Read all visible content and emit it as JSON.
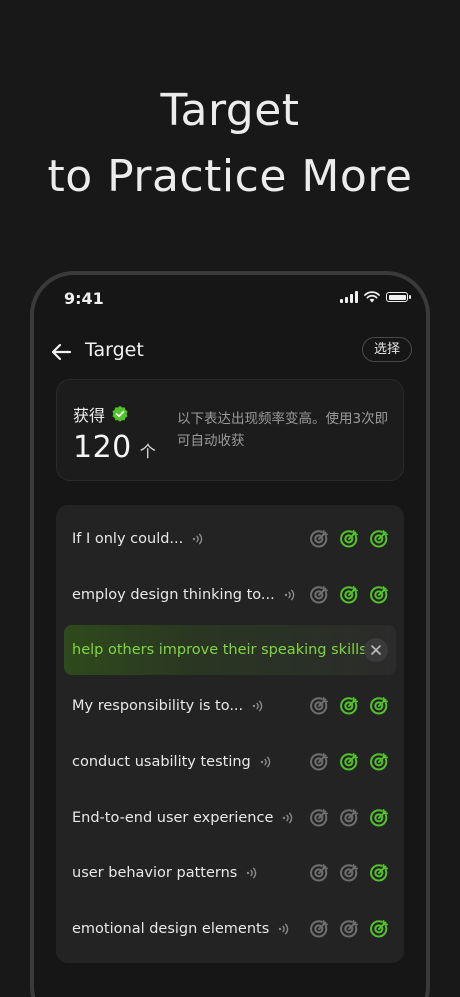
{
  "hero": {
    "line1": "Target",
    "line2": "to Practice More"
  },
  "status_bar": {
    "time": "9:41"
  },
  "nav": {
    "title": "Target",
    "select_label": "选择"
  },
  "reward": {
    "label": "获得",
    "number": "120",
    "unit": "个",
    "description": "以下表达出现频率变高。使用3次即可自动收获"
  },
  "colors": {
    "accent_green": "#52c22b",
    "inactive_gray": "#6e6e6e",
    "highlight_text": "#7fd642"
  },
  "phrases": [
    {
      "text": "If I only could...",
      "targets_done": 2
    },
    {
      "text": "employ design thinking to...",
      "targets_done": 2
    },
    {
      "text": "help others improve their speaking skills",
      "highlighted": true
    },
    {
      "text": "My responsibility is to...",
      "targets_done": 2
    },
    {
      "text": "conduct usability testing",
      "targets_done": 2
    },
    {
      "text": "End-to-end user experience",
      "targets_done": 1
    },
    {
      "text": "user behavior patterns",
      "targets_done": 1
    },
    {
      "text": "emotional design elements",
      "targets_done": 1
    }
  ]
}
